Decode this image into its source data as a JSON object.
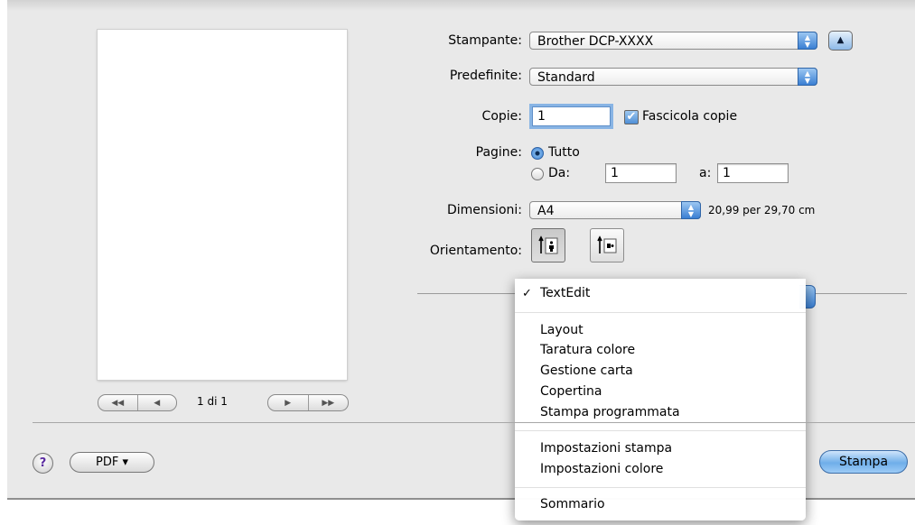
{
  "preview": {
    "page_indicator": "1 di 1"
  },
  "printer": {
    "label": "Stampante:",
    "value": "Brother DCP-XXXX"
  },
  "presets": {
    "label": "Predefinite:",
    "value": "Standard"
  },
  "copies": {
    "label": "Copie:",
    "value": "1",
    "collate_label": "Fascicola copie",
    "collate_checked": true
  },
  "pages": {
    "label": "Pagine:",
    "all_label": "Tutto",
    "from_label": "Da:",
    "from_value": "1",
    "to_label": "a:",
    "to_value": "1",
    "selected": "all"
  },
  "paper_size": {
    "label": "Dimensioni:",
    "value": "A4",
    "dimensions": "20,99 per 29,70 cm"
  },
  "orientation": {
    "label": "Orientamento:",
    "selected": "portrait"
  },
  "menu": {
    "checked_item": "TextEdit",
    "group1": [
      "Layout",
      "Taratura colore",
      "Gestione carta",
      "Copertina",
      "Stampa programmata"
    ],
    "group2": [
      "Impostazioni stampa",
      "Impostazioni colore"
    ],
    "group3": [
      "Sommario"
    ]
  },
  "footer": {
    "help": "?",
    "pdf_label": "PDF ▾",
    "print_label": "Stampa"
  }
}
